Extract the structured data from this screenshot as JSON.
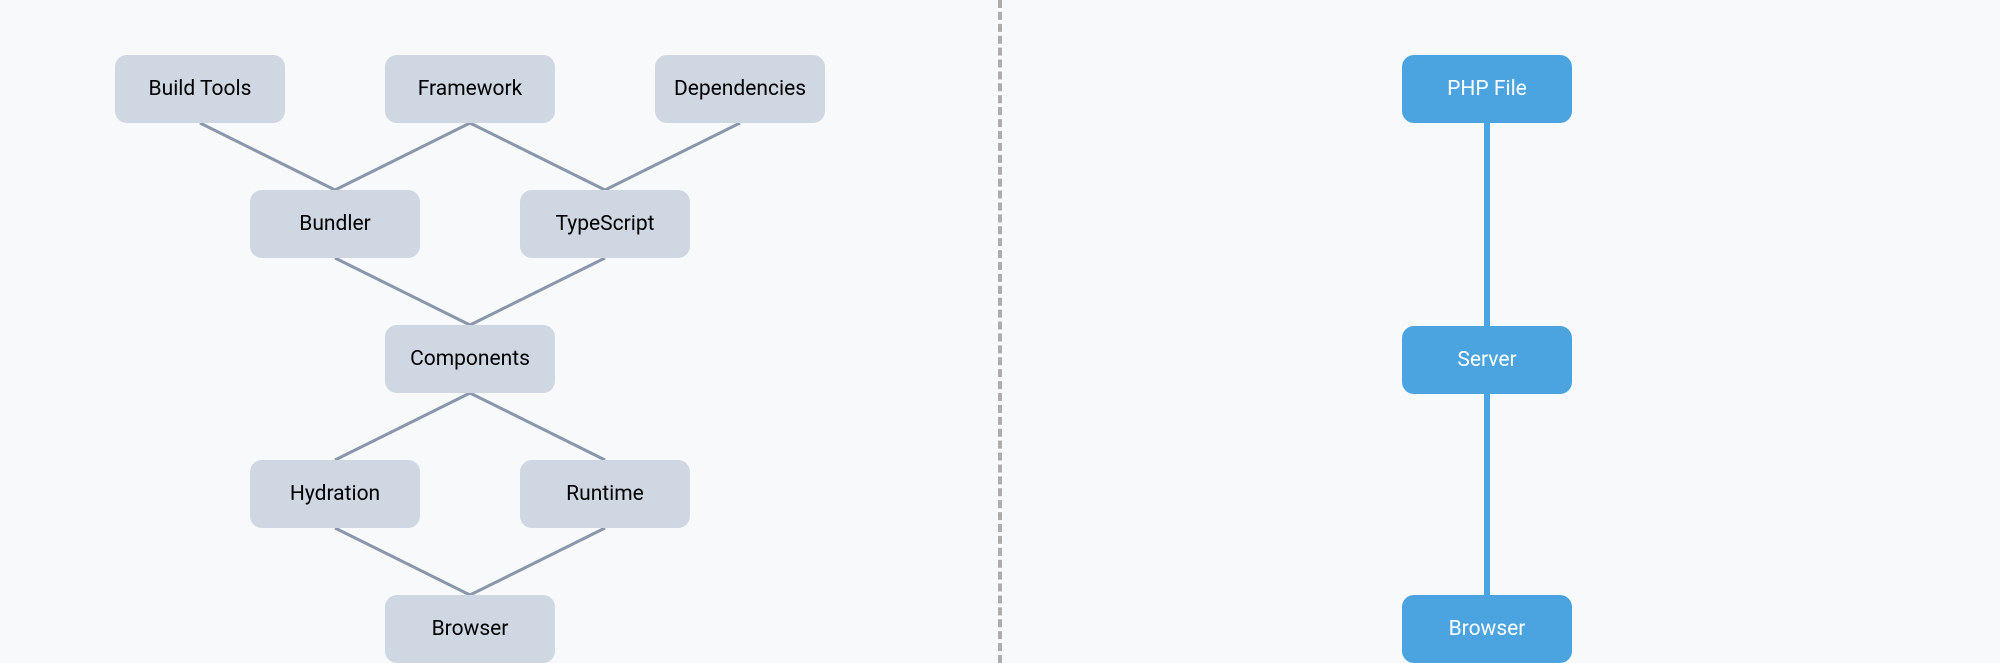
{
  "left": {
    "nodes": {
      "buildTools": "Build Tools",
      "framework": "Framework",
      "dependencies": "Dependencies",
      "bundler": "Bundler",
      "typescript": "TypeScript",
      "components": "Components",
      "hydration": "Hydration",
      "runtime": "Runtime",
      "browser": "Browser"
    },
    "edges": [
      [
        "buildTools",
        "bundler"
      ],
      [
        "framework",
        "bundler"
      ],
      [
        "framework",
        "typescript"
      ],
      [
        "dependencies",
        "typescript"
      ],
      [
        "bundler",
        "components"
      ],
      [
        "typescript",
        "components"
      ],
      [
        "components",
        "hydration"
      ],
      [
        "components",
        "runtime"
      ],
      [
        "hydration",
        "browser"
      ],
      [
        "runtime",
        "browser"
      ]
    ],
    "nodeColor": "#cfd7e3",
    "edgeColor": "#8996ab"
  },
  "right": {
    "nodes": {
      "phpFile": "PHP File",
      "server": "Server",
      "browser": "Browser"
    },
    "edges": [
      [
        "phpFile",
        "server"
      ],
      [
        "server",
        "browser"
      ]
    ],
    "nodeColor": "#4ba3df",
    "edgeColor": "#4ba3df"
  }
}
